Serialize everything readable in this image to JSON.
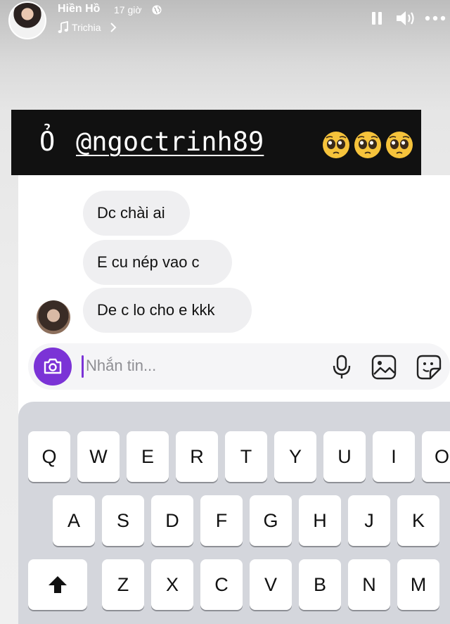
{
  "header": {
    "author": "Hiền Hồ",
    "time": "17 giờ",
    "song": "Trichia",
    "icons": [
      "globe-icon",
      "music-icon",
      "chevron-right-icon",
      "pause-icon",
      "volume-icon",
      "more-icon"
    ]
  },
  "caption": {
    "prefix": "Ỏ",
    "mention": "@ngoctrinh89",
    "emoji_count": 3,
    "emoji_icon": "pleading-face-emoji"
  },
  "chat": {
    "messages": [
      {
        "text": "Dc chài ai"
      },
      {
        "text": "E cu nép vao c"
      },
      {
        "text": "De c lo cho e kkk"
      }
    ]
  },
  "composer": {
    "placeholder": "Nhắn tin...",
    "value": "",
    "accent_color": "#7b33d6",
    "icons": [
      "camera-icon",
      "microphone-icon",
      "gallery-icon",
      "sticker-icon"
    ]
  },
  "keyboard": {
    "row1": [
      "Q",
      "W",
      "E",
      "R",
      "T",
      "Y",
      "U",
      "I",
      "O"
    ],
    "row2": [
      "A",
      "S",
      "D",
      "F",
      "G",
      "H",
      "J",
      "K"
    ],
    "row3": [
      "Z",
      "X",
      "C",
      "V",
      "B",
      "N",
      "M"
    ],
    "shift_icon": "shift-arrow-icon"
  },
  "colors": {
    "caption_background": "#111111",
    "bubble_background": "#efeff1",
    "keyboard_background": "#d4d6dc"
  }
}
